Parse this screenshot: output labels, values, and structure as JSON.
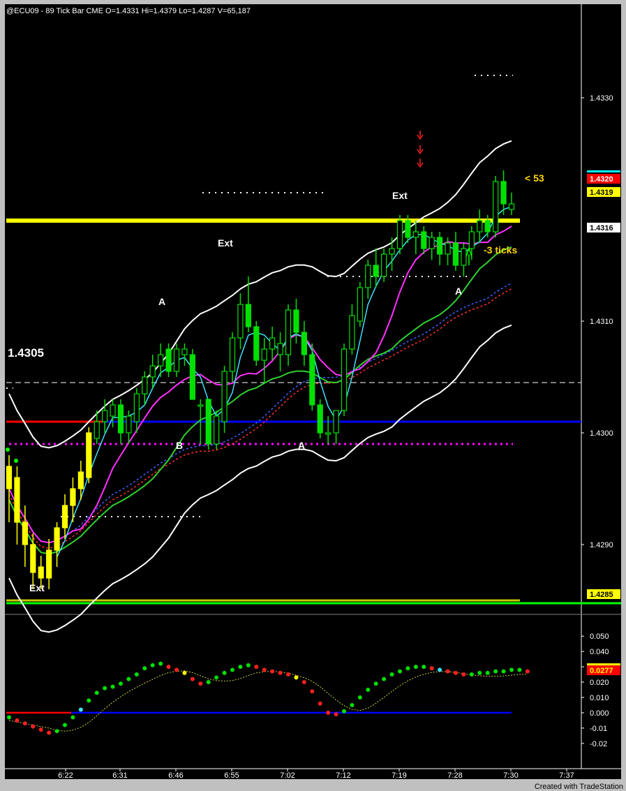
{
  "header": {
    "symbol": "@ECU09 - 89 Tick Bar  CME",
    "open": "O=1.4331",
    "high": "Hi=1.4379",
    "low": "Lo=1.4287",
    "volume": "V=65,187"
  },
  "footer": "Created with TradeStation",
  "chart_data": {
    "type": "candlestick",
    "price_axis": {
      "ticks": [
        "1.4330",
        "1.4310",
        "1.4300",
        "1.4290"
      ],
      "tick_values": [
        1.433,
        1.431,
        1.43,
        1.429
      ],
      "range": [
        1.42855,
        1.43375
      ]
    },
    "price_labels": [
      {
        "text": "1.4320",
        "value": 1.432,
        "bg": "#ff0000",
        "fg": "#ffffff"
      },
      {
        "text": "1.4319",
        "value": 1.4319,
        "bg": "#ffff00",
        "fg": "#000000"
      },
      {
        "text": "1.4316",
        "value": 1.4316,
        "bg": "#ffffff",
        "fg": "#000000"
      },
      {
        "text": "1.4285",
        "value": 1.4285,
        "bg": "#ffff00",
        "fg": "#000000"
      }
    ],
    "time_axis": [
      "6:22",
      "6:31",
      "6:46",
      "6:55",
      "7:02",
      "7:12",
      "7:19",
      "7:28",
      "7:30",
      "7:37"
    ],
    "annotations": [
      {
        "text": "A",
        "color": "#ffffff"
      },
      {
        "text": "B",
        "color": "#ffffff"
      },
      {
        "text": "Ext",
        "color": "#ffffff"
      },
      {
        "text": "A",
        "color": "#ffffff"
      },
      {
        "text": "Ext",
        "color": "#ffffff"
      },
      {
        "text": "A",
        "color": "#ffffff"
      },
      {
        "text": "Ext",
        "color": "#ffffff"
      },
      {
        "text": "1.4305",
        "color": "#ffffff"
      },
      {
        "text": "-3 ticks",
        "color": "#ffd700"
      },
      {
        "text": "<  53",
        "color": "#ffd700"
      }
    ],
    "levels": [
      {
        "name": "yellow-resistance",
        "value": 1.4319,
        "color": "#ffff00"
      },
      {
        "name": "dash-1.4305",
        "value": 1.43045,
        "color": "#ffffff"
      },
      {
        "name": "red-blue-level",
        "value": 1.4301,
        "color": "#0000ff"
      },
      {
        "name": "magenta-dots",
        "value": 1.4299,
        "color": "#ff00ff"
      },
      {
        "name": "green-bottom",
        "value": 1.4285,
        "color": "#00ff00"
      }
    ],
    "candles": [
      {
        "o": 1.4297,
        "h": 1.4298,
        "l": 1.4292,
        "c": 1.4295,
        "col": "y"
      },
      {
        "o": 1.4296,
        "h": 1.4297,
        "l": 1.429,
        "c": 1.4292,
        "col": "y"
      },
      {
        "o": 1.4292,
        "h": 1.42935,
        "l": 1.4288,
        "c": 1.429,
        "col": "y"
      },
      {
        "o": 1.429,
        "h": 1.4291,
        "l": 1.4286,
        "c": 1.42875,
        "col": "y"
      },
      {
        "o": 1.4288,
        "h": 1.4289,
        "l": 1.4286,
        "c": 1.4287,
        "col": "y"
      },
      {
        "o": 1.4287,
        "h": 1.42905,
        "l": 1.4286,
        "c": 1.42895,
        "col": "y"
      },
      {
        "o": 1.42895,
        "h": 1.4292,
        "l": 1.4288,
        "c": 1.42915,
        "col": "y"
      },
      {
        "o": 1.42915,
        "h": 1.42945,
        "l": 1.42905,
        "c": 1.42935,
        "col": "y"
      },
      {
        "o": 1.42935,
        "h": 1.4296,
        "l": 1.4292,
        "c": 1.4295,
        "col": "y"
      },
      {
        "o": 1.4295,
        "h": 1.42975,
        "l": 1.4294,
        "c": 1.42965,
        "col": "y"
      },
      {
        "o": 1.4296,
        "h": 1.43005,
        "l": 1.42955,
        "c": 1.43,
        "col": "y"
      },
      {
        "o": 1.42995,
        "h": 1.4302,
        "l": 1.4299,
        "c": 1.4301,
        "col": "g"
      },
      {
        "o": 1.4301,
        "h": 1.4303,
        "l": 1.43,
        "c": 1.4302,
        "col": "g"
      },
      {
        "o": 1.43015,
        "h": 1.4303,
        "l": 1.43005,
        "c": 1.43025,
        "col": "g"
      },
      {
        "o": 1.43025,
        "h": 1.4303,
        "l": 1.4299,
        "c": 1.43,
        "col": "gf"
      },
      {
        "o": 1.43,
        "h": 1.4302,
        "l": 1.4299,
        "c": 1.43015,
        "col": "g"
      },
      {
        "o": 1.4301,
        "h": 1.4304,
        "l": 1.43,
        "c": 1.43035,
        "col": "g"
      },
      {
        "o": 1.43035,
        "h": 1.43055,
        "l": 1.43025,
        "c": 1.4305,
        "col": "g"
      },
      {
        "o": 1.4305,
        "h": 1.4307,
        "l": 1.4304,
        "c": 1.4306,
        "col": "g"
      },
      {
        "o": 1.4306,
        "h": 1.4308,
        "l": 1.4305,
        "c": 1.4307,
        "col": "g"
      },
      {
        "o": 1.43075,
        "h": 1.4308,
        "l": 1.4305,
        "c": 1.43055,
        "col": "gf"
      },
      {
        "o": 1.43055,
        "h": 1.4308,
        "l": 1.4305,
        "c": 1.43075,
        "col": "g"
      },
      {
        "o": 1.43075,
        "h": 1.4308,
        "l": 1.4306,
        "c": 1.4307,
        "col": "g"
      },
      {
        "o": 1.4307,
        "h": 1.43075,
        "l": 1.4303,
        "c": 1.4303,
        "col": "gf"
      },
      {
        "o": 1.43025,
        "h": 1.4303,
        "l": 1.4299,
        "c": 1.43025,
        "col": "g"
      },
      {
        "o": 1.4303,
        "h": 1.4303,
        "l": 1.42985,
        "c": 1.4299,
        "col": "gf"
      },
      {
        "o": 1.4299,
        "h": 1.4302,
        "l": 1.42985,
        "c": 1.43015,
        "col": "g"
      },
      {
        "o": 1.4301,
        "h": 1.4306,
        "l": 1.43,
        "c": 1.43055,
        "col": "g"
      },
      {
        "o": 1.43055,
        "h": 1.4309,
        "l": 1.43045,
        "c": 1.43085,
        "col": "g"
      },
      {
        "o": 1.43085,
        "h": 1.43125,
        "l": 1.43075,
        "c": 1.43115,
        "col": "g"
      },
      {
        "o": 1.43115,
        "h": 1.4314,
        "l": 1.4309,
        "c": 1.43095,
        "col": "gf"
      },
      {
        "o": 1.43095,
        "h": 1.431,
        "l": 1.4306,
        "c": 1.43065,
        "col": "gf"
      },
      {
        "o": 1.43065,
        "h": 1.43085,
        "l": 1.43045,
        "c": 1.43075,
        "col": "g"
      },
      {
        "o": 1.43075,
        "h": 1.43095,
        "l": 1.43065,
        "c": 1.43085,
        "col": "g"
      },
      {
        "o": 1.4308,
        "h": 1.4309,
        "l": 1.43055,
        "c": 1.4307,
        "col": "g"
      },
      {
        "o": 1.4307,
        "h": 1.43115,
        "l": 1.4306,
        "c": 1.4311,
        "col": "g"
      },
      {
        "o": 1.4311,
        "h": 1.4312,
        "l": 1.4308,
        "c": 1.4309,
        "col": "gf"
      },
      {
        "o": 1.4309,
        "h": 1.431,
        "l": 1.4306,
        "c": 1.4307,
        "col": "gf"
      },
      {
        "o": 1.4307,
        "h": 1.4308,
        "l": 1.4302,
        "c": 1.43025,
        "col": "gf"
      },
      {
        "o": 1.43025,
        "h": 1.4303,
        "l": 1.42995,
        "c": 1.43,
        "col": "gf"
      },
      {
        "o": 1.43,
        "h": 1.43015,
        "l": 1.4299,
        "c": 1.43,
        "col": "g"
      },
      {
        "o": 1.43,
        "h": 1.4302,
        "l": 1.4299,
        "c": 1.4302,
        "col": "g"
      },
      {
        "o": 1.4302,
        "h": 1.4308,
        "l": 1.43015,
        "c": 1.43075,
        "col": "g"
      },
      {
        "o": 1.43075,
        "h": 1.43115,
        "l": 1.4307,
        "c": 1.43105,
        "col": "g"
      },
      {
        "o": 1.431,
        "h": 1.43135,
        "l": 1.43095,
        "c": 1.4313,
        "col": "g"
      },
      {
        "o": 1.4313,
        "h": 1.43155,
        "l": 1.4312,
        "c": 1.4315,
        "col": "g"
      },
      {
        "o": 1.4315,
        "h": 1.43165,
        "l": 1.4313,
        "c": 1.4314,
        "col": "gf"
      },
      {
        "o": 1.4314,
        "h": 1.43165,
        "l": 1.43135,
        "c": 1.4316,
        "col": "g"
      },
      {
        "o": 1.4316,
        "h": 1.43175,
        "l": 1.43145,
        "c": 1.43165,
        "col": "g"
      },
      {
        "o": 1.43165,
        "h": 1.43195,
        "l": 1.4316,
        "c": 1.4319,
        "col": "g"
      },
      {
        "o": 1.4319,
        "h": 1.43195,
        "l": 1.4317,
        "c": 1.43175,
        "col": "gf"
      },
      {
        "o": 1.43175,
        "h": 1.4319,
        "l": 1.4316,
        "c": 1.4318,
        "col": "g"
      },
      {
        "o": 1.4318,
        "h": 1.43185,
        "l": 1.4316,
        "c": 1.43165,
        "col": "gf"
      },
      {
        "o": 1.43165,
        "h": 1.4318,
        "l": 1.43155,
        "c": 1.43175,
        "col": "g"
      },
      {
        "o": 1.43175,
        "h": 1.4318,
        "l": 1.4315,
        "c": 1.4316,
        "col": "gf"
      },
      {
        "o": 1.4316,
        "h": 1.43175,
        "l": 1.4315,
        "c": 1.4317,
        "col": "g"
      },
      {
        "o": 1.4317,
        "h": 1.4318,
        "l": 1.43145,
        "c": 1.4315,
        "col": "gf"
      },
      {
        "o": 1.4315,
        "h": 1.4317,
        "l": 1.4314,
        "c": 1.43165,
        "col": "g"
      },
      {
        "o": 1.43165,
        "h": 1.43185,
        "l": 1.43155,
        "c": 1.4318,
        "col": "g"
      },
      {
        "o": 1.4318,
        "h": 1.432,
        "l": 1.4317,
        "c": 1.4319,
        "col": "g"
      },
      {
        "o": 1.4319,
        "h": 1.43195,
        "l": 1.43175,
        "c": 1.4318,
        "col": "gf"
      },
      {
        "o": 1.4318,
        "h": 1.4323,
        "l": 1.43175,
        "c": 1.43225,
        "col": "g"
      },
      {
        "o": 1.43225,
        "h": 1.43235,
        "l": 1.43195,
        "c": 1.43205,
        "col": "gf"
      },
      {
        "o": 1.43205,
        "h": 1.43215,
        "l": 1.43195,
        "c": 1.432,
        "col": "g"
      }
    ],
    "oscillator": {
      "ticks": [
        "0.050",
        "0.040",
        "0.030",
        "0.020",
        "0.010",
        "0.000",
        "-0.01",
        "-0.02"
      ],
      "tick_values": [
        0.05,
        0.04,
        0.03,
        0.02,
        0.01,
        0.0,
        -0.01,
        -0.02
      ],
      "range": [
        -0.026,
        0.056
      ],
      "value_label": {
        "text": "0.0277",
        "value": 0.0277
      },
      "values": [
        -0.003,
        -0.005,
        -0.007,
        -0.009,
        -0.011,
        -0.013,
        -0.012,
        -0.008,
        -0.003,
        0.002,
        0.008,
        0.013,
        0.016,
        0.017,
        0.019,
        0.022,
        0.025,
        0.029,
        0.031,
        0.032,
        0.03,
        0.028,
        0.026,
        0.022,
        0.019,
        0.02,
        0.023,
        0.026,
        0.028,
        0.03,
        0.031,
        0.03,
        0.028,
        0.027,
        0.026,
        0.025,
        0.023,
        0.02,
        0.014,
        0.006,
        0.0,
        -0.001,
        0.001,
        0.005,
        0.01,
        0.015,
        0.019,
        0.022,
        0.025,
        0.027,
        0.029,
        0.03,
        0.03,
        0.029,
        0.028,
        0.027,
        0.026,
        0.025,
        0.025,
        0.026,
        0.026,
        0.027,
        0.027,
        0.028,
        0.028,
        0.027
      ]
    }
  }
}
